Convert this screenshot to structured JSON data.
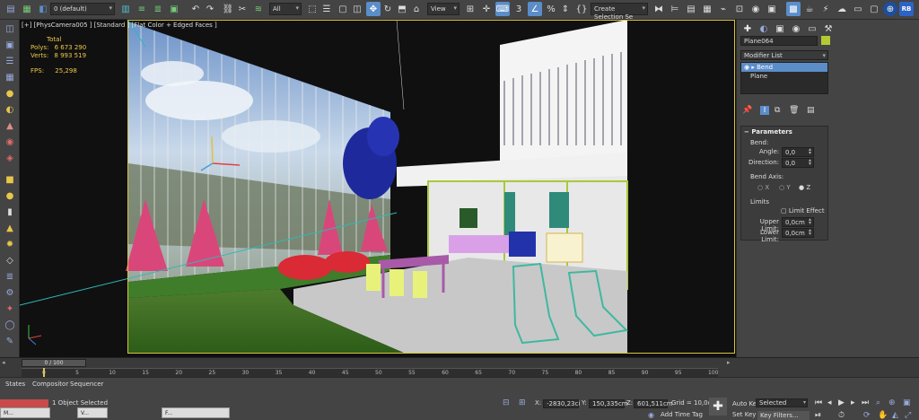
{
  "toolbar": {
    "layer_combo": "0 (default)",
    "filter_combo": "All",
    "view_combo": "View",
    "selection_set_combo": "Create Selection Se"
  },
  "viewport": {
    "label": "[+] [PhysCamera005 ] [Standard ] [Flat Color + Edged Faces ]",
    "stats": {
      "total_label": "Total",
      "polys_label": "Polys:",
      "polys_value": "6 673 290",
      "verts_label": "Verts:",
      "verts_value": "8 993 519",
      "fps_label": "FPS:",
      "fps_value": "25,298"
    }
  },
  "command_panel": {
    "object_name": "Plane064",
    "object_color": "#b5c934",
    "modifier_list_label": "Modifier List",
    "stack": [
      "Bend",
      "Plane"
    ],
    "rollout_title": "Parameters",
    "bend_label": "Bend:",
    "angle_label": "Angle:",
    "angle_value": "0,0",
    "direction_label": "Direction:",
    "direction_value": "0,0",
    "bend_axis_label": "Bend Axis:",
    "axis_x": "X",
    "axis_y": "Y",
    "axis_z": "Z",
    "limits_label": "Limits",
    "limit_effect_label": "Limit Effect",
    "upper_limit_label": "Upper Limit:",
    "upper_limit_value": "0,0cm",
    "lower_limit_label": "Lower Limit:",
    "lower_limit_value": "0,0cm"
  },
  "timeline": {
    "frame_counter": "0 / 100",
    "ticks": [
      "0",
      "5",
      "10",
      "15",
      "20",
      "25",
      "30",
      "35",
      "40",
      "45",
      "50",
      "55",
      "60",
      "65",
      "70",
      "75",
      "80",
      "85",
      "90",
      "95",
      "100"
    ]
  },
  "status": {
    "tabs": [
      "States",
      "Compositor",
      "Sequencer"
    ],
    "message": "1 Object Selected",
    "x_label": "X:",
    "x_value": "-2830,23ci",
    "y_label": "Y:",
    "y_value": "150,335cm",
    "z_label": "Z:",
    "z_value": "601,511cm",
    "grid": "Grid = 10,0cm",
    "add_time_tag": "Add Time Tag",
    "auto_key": "Auto Key",
    "set_key": "Set Key",
    "selected_combo": "Selected",
    "key_filters": "Key Filters...",
    "taskbar_items": [
      "M...",
      "V...",
      "F..."
    ]
  },
  "colors": {
    "accent": "#5b8dc9",
    "viewport_frame": "#d6c43c",
    "stats_text": "#f0c84a",
    "time_slider_red": "#c94a4a"
  }
}
